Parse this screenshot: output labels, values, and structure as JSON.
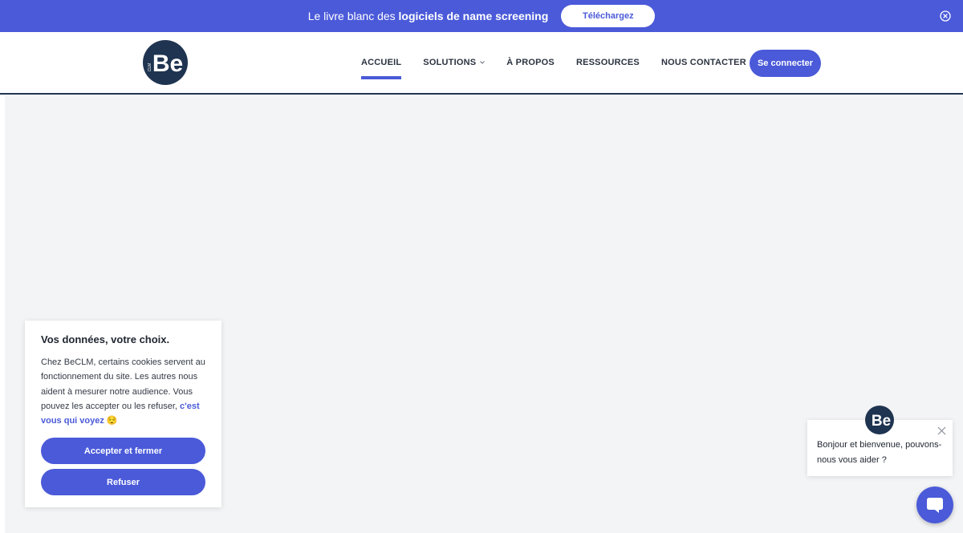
{
  "announcement": {
    "text_prefix": "Le livre blanc des ",
    "text_bold": "logiciels de name screening",
    "button_label": "Téléchargez"
  },
  "header": {
    "logo_text": "Be",
    "logo_subtext": "CLM",
    "nav": [
      {
        "label": "ACCUEIL",
        "active": true
      },
      {
        "label": "SOLUTIONS",
        "has_dropdown": true
      },
      {
        "label": "À PROPOS"
      },
      {
        "label": "RESSOURCES"
      },
      {
        "label": "NOUS CONTACTER"
      }
    ],
    "connect_label": "Se connecter"
  },
  "cookie_banner": {
    "title": "Vos données, votre choix.",
    "body": "Chez BeCLM, certains cookies servent au fonctionnement du site. Les autres nous aident à mesurer notre audience. Vous pouvez les accepter ou les refuser,",
    "link": "c'est vous qui voyez",
    "emoji": "😌",
    "accept_label": "Accepter et fermer",
    "refuse_label": "Refuser"
  },
  "chat_widget": {
    "message": "Bonjour et bienvenue, pouvons-nous vous aider ?",
    "avatar_text": "Be"
  },
  "colors": {
    "brand": "#4a5ad9",
    "navy": "#1f3450",
    "page_bg": "#f3f4f6"
  }
}
